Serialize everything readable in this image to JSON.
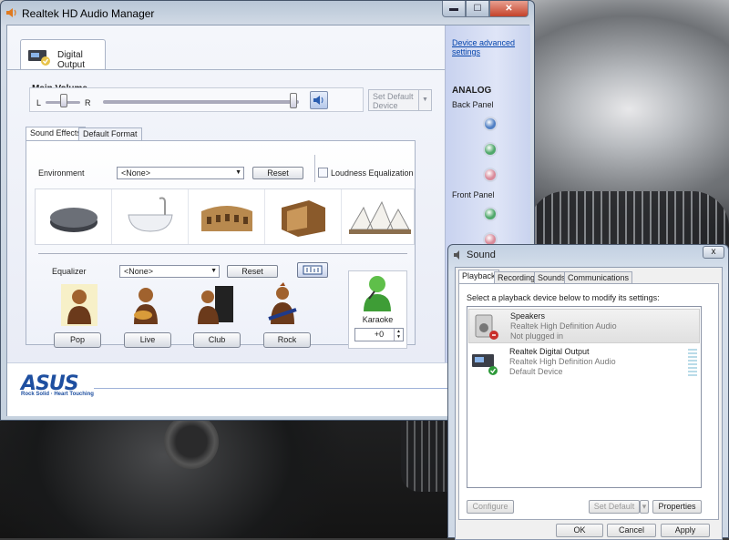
{
  "realtek": {
    "title": "Realtek HD Audio Manager",
    "device_tab": "Digital Output",
    "main_volume_label": "Main Volume",
    "balance_left": "L",
    "balance_right": "R",
    "volume_level": 0.98,
    "set_default_label": "Set Default Device",
    "tabs": {
      "sound_effects": "Sound Effects",
      "default_format": "Default Format"
    },
    "environment": {
      "label": "Environment",
      "value": "<None>",
      "reset": "Reset"
    },
    "loudness_label": "Loudness Equalization",
    "equalizer": {
      "label": "Equalizer",
      "value": "<None>",
      "reset": "Reset"
    },
    "presets": [
      "Pop",
      "Live",
      "Club",
      "Rock"
    ],
    "karaoke": {
      "label": "Karaoke",
      "value": "+0"
    },
    "side": {
      "advanced_link": "Device advanced settings",
      "analog": "ANALOG",
      "back_panel": "Back Panel",
      "front_panel": "Front Panel",
      "jack_colors": [
        "#4f7fc4",
        "#4fa86a",
        "#d98a9a",
        "#4fa86a",
        "#d98a9a"
      ]
    },
    "brand": {
      "logo": "ASUS",
      "tagline": "Rock Solid · Heart Touching"
    }
  },
  "sound": {
    "title": "Sound",
    "close": "x",
    "tabs": [
      "Playback",
      "Recording",
      "Sounds",
      "Communications"
    ],
    "instruction": "Select a playback device below to modify its settings:",
    "devices": [
      {
        "name": "Speakers",
        "driver": "Realtek High Definition Audio",
        "status": "Not plugged in"
      },
      {
        "name": "Realtek Digital Output",
        "driver": "Realtek High Definition Audio",
        "status": "Default Device"
      }
    ],
    "buttons": {
      "configure": "Configure",
      "set_default": "Set Default",
      "properties": "Properties",
      "ok": "OK",
      "cancel": "Cancel",
      "apply": "Apply"
    }
  }
}
